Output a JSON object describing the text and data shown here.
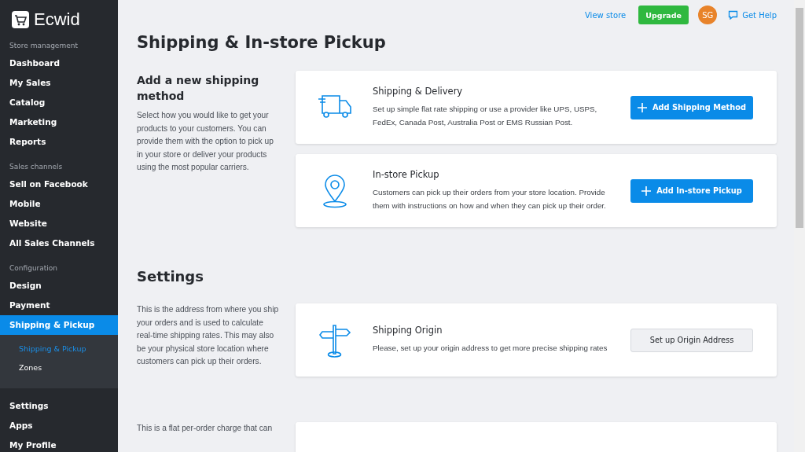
{
  "sidebar": {
    "logo": "Ecwid",
    "sections": [
      {
        "heading": "Store management",
        "items": [
          {
            "label": "Dashboard",
            "selected": false
          },
          {
            "label": "My Sales",
            "selected": false
          },
          {
            "label": "Catalog",
            "selected": false
          },
          {
            "label": "Marketing",
            "selected": false
          },
          {
            "label": "Reports",
            "selected": false
          }
        ]
      },
      {
        "heading": "Sales channels",
        "items": [
          {
            "label": "Sell on Facebook",
            "selected": false
          },
          {
            "label": "Mobile",
            "selected": false
          },
          {
            "label": "Website",
            "selected": false
          },
          {
            "label": "All Sales Channels",
            "selected": false
          }
        ]
      },
      {
        "heading": "Configuration",
        "items": [
          {
            "label": "Design",
            "selected": false
          },
          {
            "label": "Payment",
            "selected": false
          },
          {
            "label": "Shipping & Pickup",
            "selected": true,
            "expanded": true,
            "children": [
              {
                "label": "Shipping & Pickup",
                "selected": true
              },
              {
                "label": "Zones",
                "selected": false
              }
            ]
          }
        ]
      },
      {
        "items": [
          {
            "label": "Settings",
            "selected": false
          },
          {
            "label": "Apps",
            "selected": false
          },
          {
            "label": "My Profile",
            "selected": false
          }
        ]
      }
    ]
  },
  "topbar": {
    "view_store": "View store",
    "upgrade": "Upgrade",
    "avatar": "SG",
    "help": "Get Help"
  },
  "page_title": "Shipping & In-store Pickup",
  "sections": [
    {
      "heading": "Add a new shipping method",
      "description": "Select how you would like to get your products to your customers. You can provide them with the option to pick up in your store or deliver your products using the most popular carriers.",
      "cards": [
        {
          "title": "Shipping & Delivery",
          "text": "Set up simple flat rate shipping or use a provider like UPS, USPS, FedEx, Canada Post, Australia Post or EMS Russian Post.",
          "button": "Add Shipping Method",
          "primary": true
        },
        {
          "title": "In-store Pickup",
          "text": "Customers can pick up their orders from your store location. Provide them with instructions on how and when they can pick up their order.",
          "button": "Add In-store Pickup",
          "primary": true
        }
      ]
    },
    {
      "title": "Settings",
      "description": "This is the address from where you ship your orders and is used to calculate real-time shipping rates. This may also be your physical store location where customers can pick up their orders.",
      "cards": [
        {
          "title": "Shipping Origin",
          "text": "Please, set up your origin address to get more precise shipping rates",
          "button": "Set up Origin Address",
          "primary": false
        }
      ]
    },
    {
      "description": "This is a flat per-order charge that can",
      "card_cut": true
    }
  ]
}
